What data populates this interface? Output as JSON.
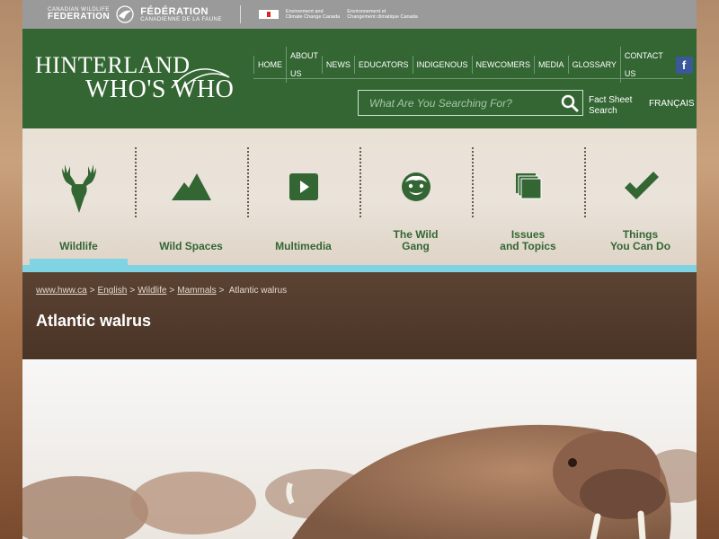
{
  "topbar": {
    "cwf_small": "CANADIAN WILDLIFE",
    "cwf_big": "FEDERATION",
    "fcf_big": "FÉDÉRATION",
    "fcf_small": "CANADIENNE DE LA FAUNE",
    "eccc_en": "Environment and\nClimate Change Canada",
    "eccc_fr": "Environnement et\nChangement climatique Canada"
  },
  "logo": {
    "line1": "HINTERLAND",
    "line2": "WHO'S WHO"
  },
  "nav": {
    "items": [
      "HOME",
      "ABOUT US",
      "NEWS",
      "EDUCATORS",
      "INDIGENOUS",
      "NEWCOMERS",
      "MEDIA",
      "GLOSSARY",
      "CONTACT US"
    ],
    "social": [
      "facebook-icon",
      "twitter-icon",
      "youtube-icon"
    ]
  },
  "search": {
    "placeholder": "What Are You Searching For?",
    "fact_sheet": "Fact Sheet\nSearch",
    "language": "FRANÇAIS"
  },
  "categories": [
    {
      "label": "Wildlife",
      "icon": "deer-icon",
      "active": true
    },
    {
      "label": "Wild Spaces",
      "icon": "mountain-icon",
      "active": false
    },
    {
      "label": "Multimedia",
      "icon": "play-icon",
      "active": false
    },
    {
      "label": "The Wild\nGang",
      "icon": "face-icon",
      "active": false
    },
    {
      "label": "Issues\nand Topics",
      "icon": "pages-icon",
      "active": false
    },
    {
      "label": "Things\nYou Can Do",
      "icon": "checkmark-icon",
      "active": false
    }
  ],
  "breadcrumb": {
    "items": [
      "www.hww.ca",
      "English",
      "Wildlife",
      "Mammals"
    ],
    "current": "Atlantic walrus"
  },
  "page_title": "Atlantic walrus",
  "colors": {
    "header_green": "#336633",
    "accent_blue": "#7fd3e2",
    "title_band": "#4a3426"
  }
}
